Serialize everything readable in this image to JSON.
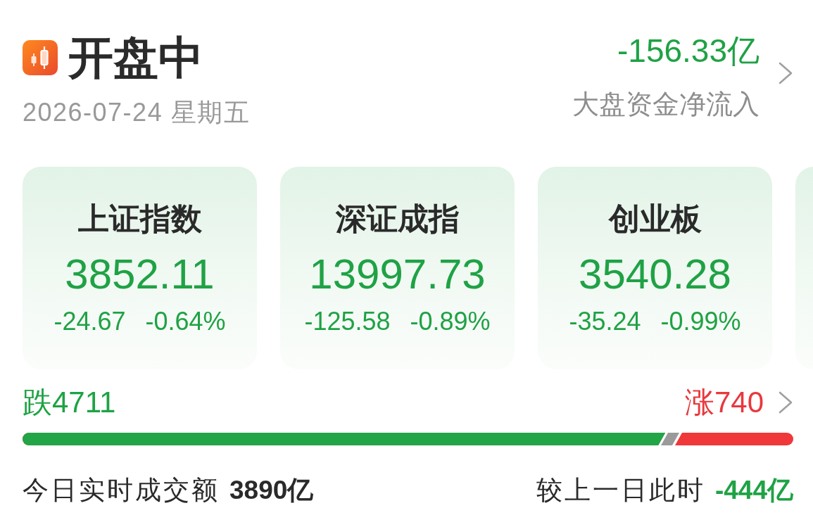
{
  "header": {
    "title": "开盘中",
    "date": "2026-07-24 星期五",
    "net_inflow": {
      "value": "-156.33亿",
      "label": "大盘资金净流入"
    }
  },
  "indices": [
    {
      "name": "上证指数",
      "value": "3852.11",
      "change": "-24.67",
      "change_pct": "-0.64%",
      "falling": true
    },
    {
      "name": "深证成指",
      "value": "13997.73",
      "change": "-125.58",
      "change_pct": "-0.89%",
      "falling": true
    },
    {
      "name": "创业板",
      "value": "3540.28",
      "change": "-35.24",
      "change_pct": "-0.99%",
      "falling": true
    }
  ],
  "indices_more_card": true,
  "breadth": {
    "down_label": "跌4711",
    "up_label": "涨740",
    "bar": {
      "level": 0.834
    }
  },
  "turnover": {
    "label": "今日实时成交额",
    "value": "3890亿",
    "compare_label": "较上一日此时",
    "compare_value": "-444亿"
  }
}
